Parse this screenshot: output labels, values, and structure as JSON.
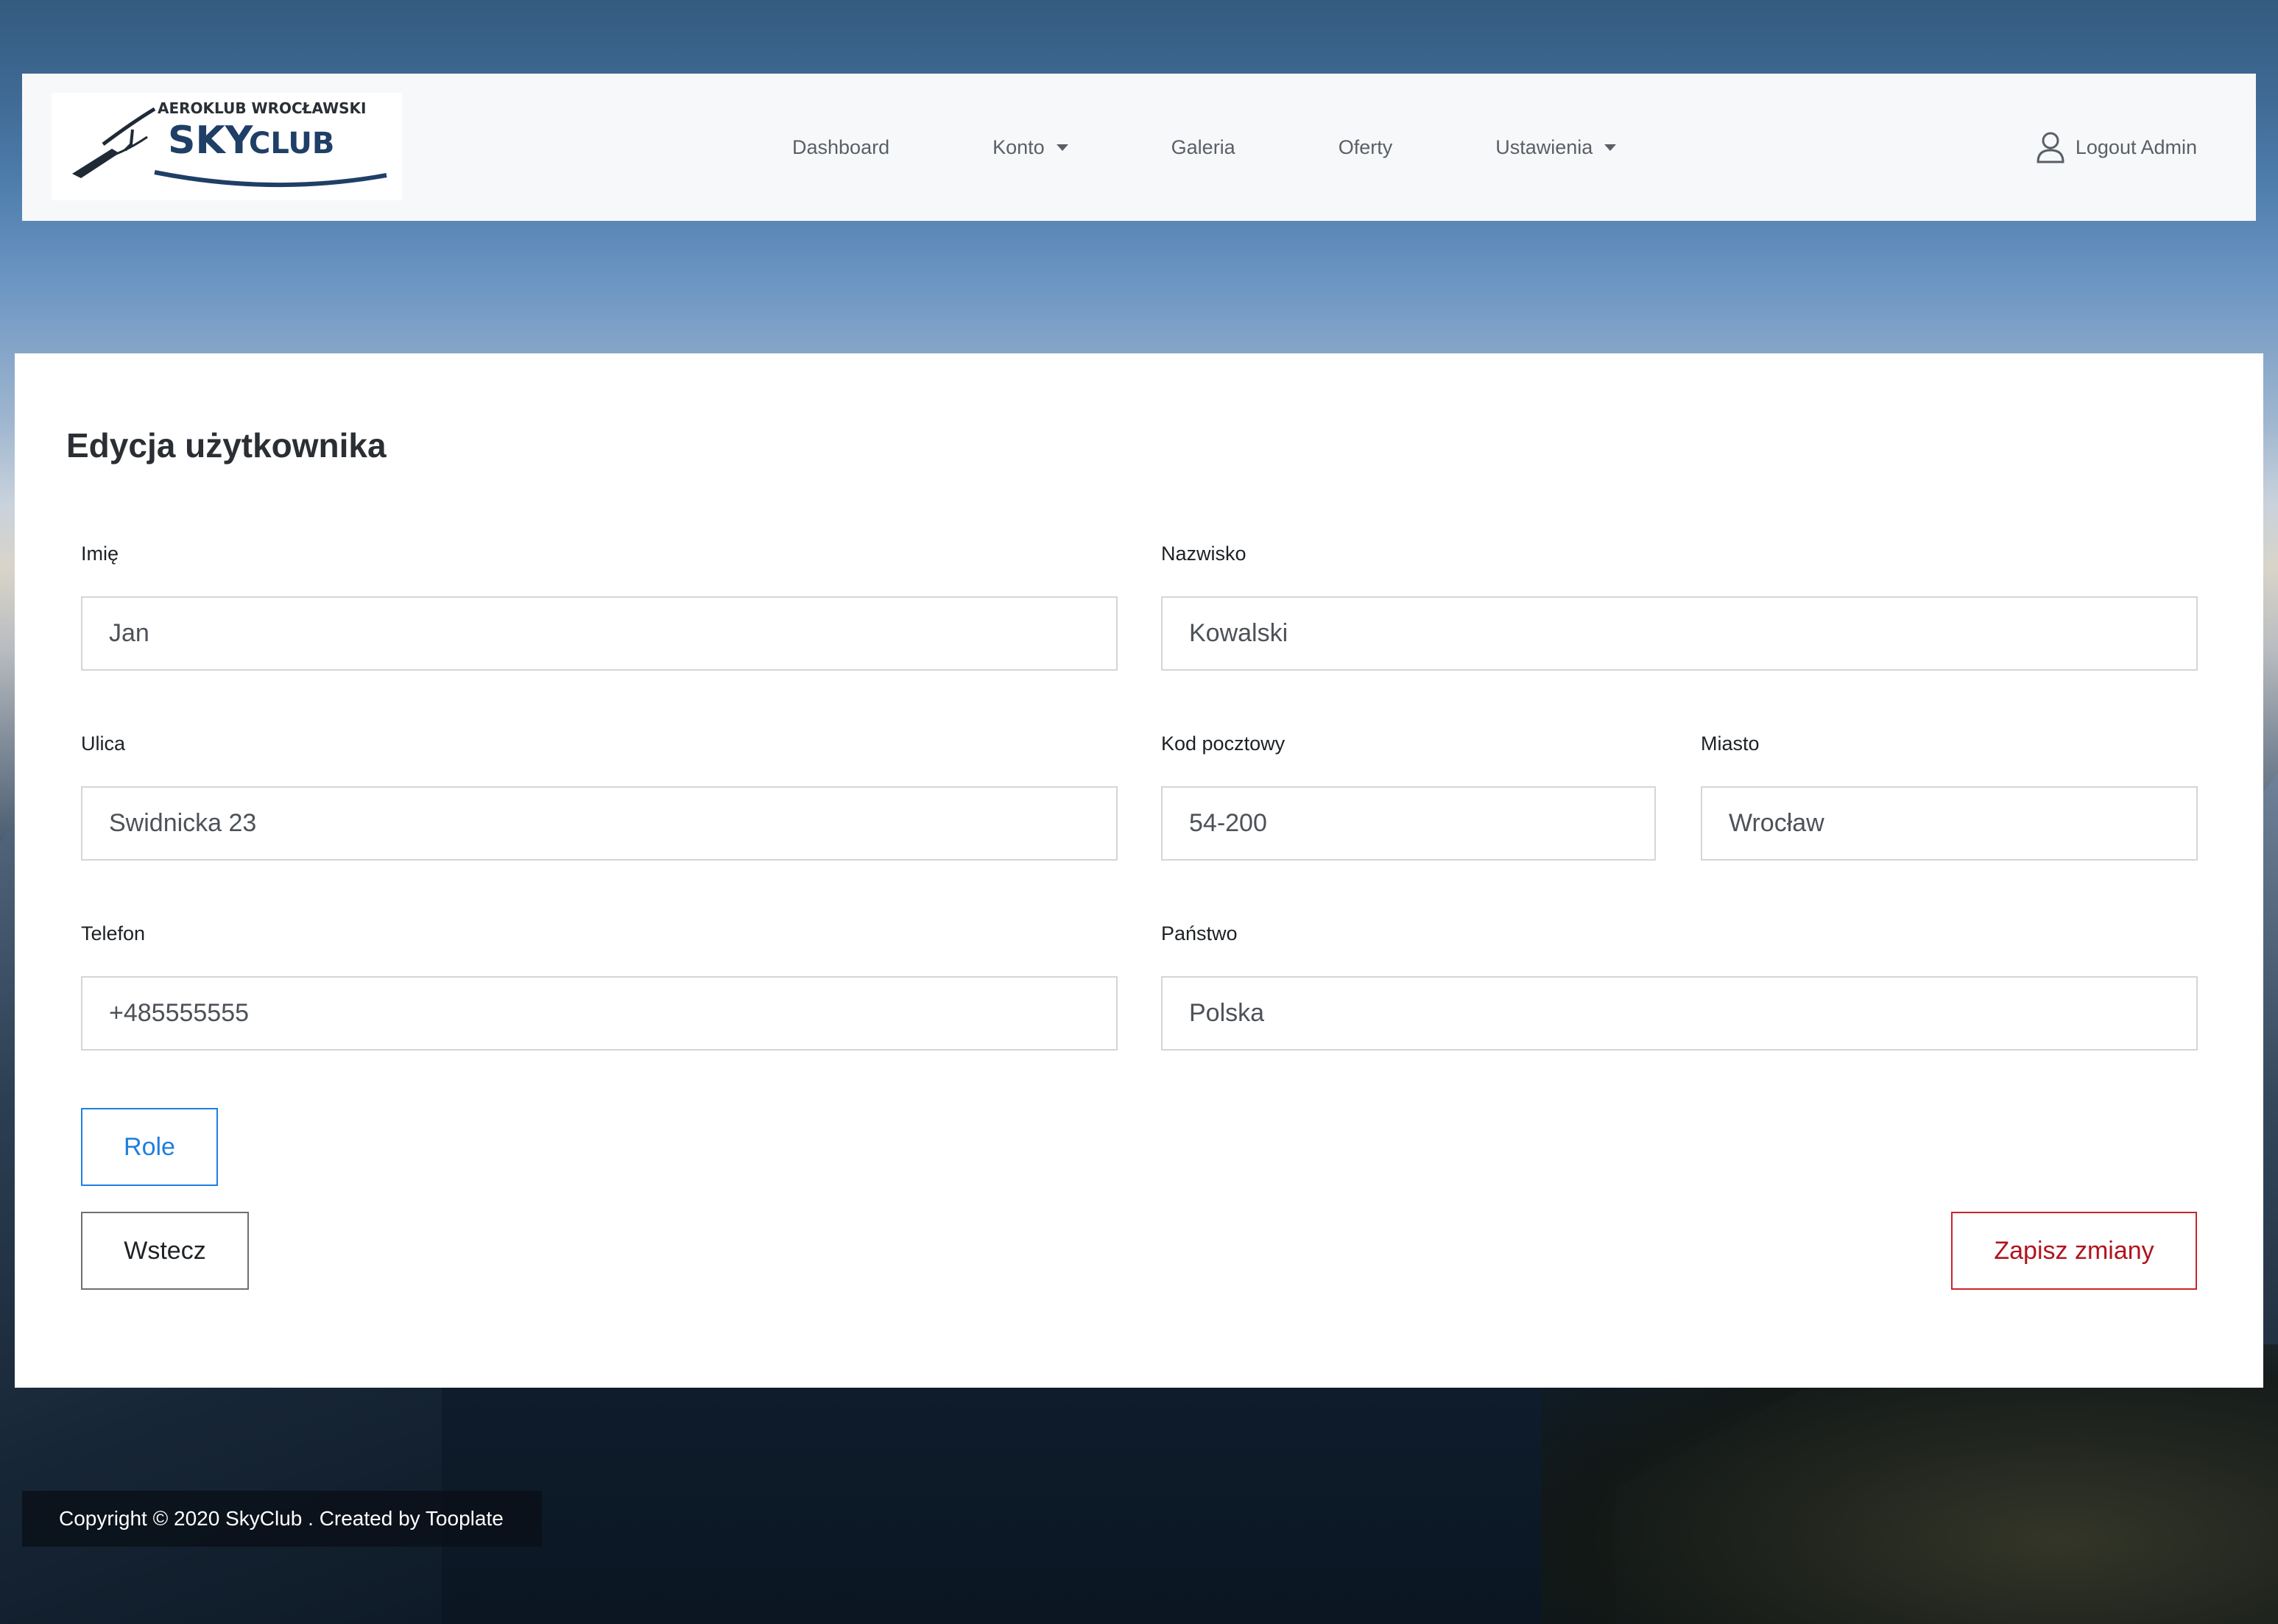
{
  "logo": {
    "line1": "AEROKLUB WROCŁAWSKI",
    "brand_sky": "SKY",
    "brand_club": "CLUB"
  },
  "nav": {
    "dashboard": "Dashboard",
    "konto": "Konto",
    "galeria": "Galeria",
    "oferty": "Oferty",
    "ustawienia": "Ustawienia",
    "logout": "Logout Admin"
  },
  "form": {
    "title": "Edycja użytkownika",
    "fields": {
      "imie": {
        "label": "Imię",
        "value": "Jan"
      },
      "nazwisko": {
        "label": "Nazwisko",
        "value": "Kowalski"
      },
      "ulica": {
        "label": "Ulica",
        "value": "Swidnicka 23"
      },
      "kod": {
        "label": "Kod pocztowy",
        "value": "54-200"
      },
      "miasto": {
        "label": "Miasto",
        "value": "Wrocław"
      },
      "telefon": {
        "label": "Telefon",
        "value": "+485555555"
      },
      "panstwo": {
        "label": "Państwo",
        "value": "Polska"
      }
    },
    "buttons": {
      "role": "Role",
      "back": "Wstecz",
      "save": "Zapisz zmiany"
    }
  },
  "footer": {
    "copyright": "Copyright © 2020 SkyClub . Created by Tooplate"
  },
  "colors": {
    "primary": "#1e7fe0",
    "danger": "#b0141d",
    "brand_dark": "#1f3f66"
  }
}
